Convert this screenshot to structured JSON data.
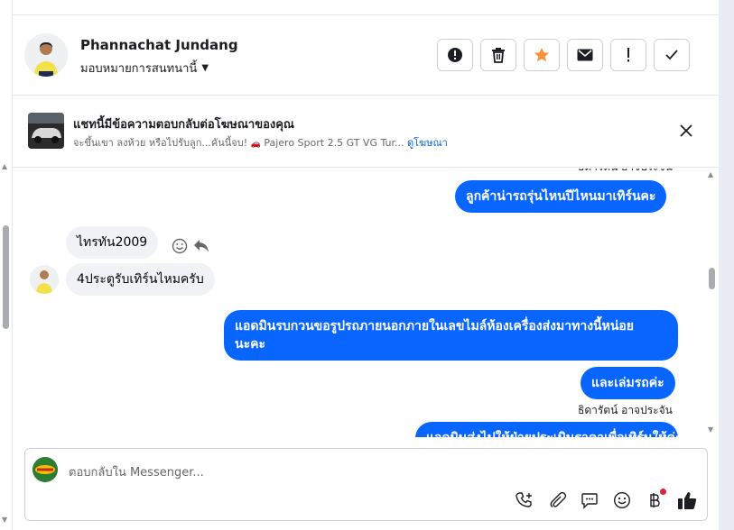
{
  "contact": {
    "name": "Phannachat Jundang",
    "assign_label": "มอบหมายการสนทนานี้"
  },
  "header_actions": [
    {
      "name": "spam-report",
      "icon": "alert-circle-icon"
    },
    {
      "name": "delete",
      "icon": "trash-icon"
    },
    {
      "name": "star",
      "icon": "star-icon",
      "color": "#f7923a"
    },
    {
      "name": "mark-unread",
      "icon": "envelope-icon"
    },
    {
      "name": "follow-up",
      "icon": "exclamation-icon"
    },
    {
      "name": "mark-done",
      "icon": "check-icon"
    }
  ],
  "ad_banner": {
    "title": "แชทนี้มีข้อความตอบกลับต่อโฆษณาของคุณ",
    "subtitle": "จะขึ้นเขา ลงห้วย หรือไปรับลูก...คันนี้จบ!",
    "product": "Pajero Sport 2.5 GT VG Tur...",
    "link": "ดูโฆษณา"
  },
  "messages": {
    "sender_top": "ธิดารัตน์ อาจประจัน",
    "out_1": "ลูกค้าน่ารถรุ่นไหนปีไหนมาเทิร์นคะ",
    "in_1": "ไทรทัน2009",
    "in_2": "4ประตูรับเทิร์นไหมครับ",
    "out_2_line1": "แอดมินรบกวนขอรูปรถภายนอกภายในเลขไมล์ห้องเครื่องส่งมาทางนี้หน่อย",
    "out_2_line2": "นะคะ",
    "out_3": "และเล่มรถค่ะ",
    "sender_bottom": "ธิดารัตน์ อาจประจัน",
    "out_4_partial": "แอดมินส่งไปให้ฝ่ายประเมินราคาเพื่อเทิร์นให้ค่ะ"
  },
  "composer": {
    "placeholder": "ตอบกลับใน Messenger...",
    "icons": [
      "call-add-icon",
      "paperclip-icon",
      "saved-reply-icon",
      "emoji-icon",
      "baht-icon",
      "thumbs-up-icon"
    ]
  },
  "colors": {
    "outgoing_bubble": "#0866ff",
    "incoming_bubble": "#f0f2f5",
    "link": "#0064d1",
    "star": "#f7923a"
  }
}
